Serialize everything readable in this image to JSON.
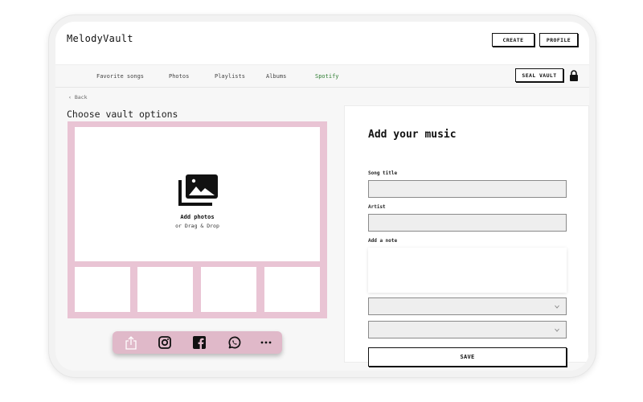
{
  "app": {
    "name": "MelodyVault"
  },
  "header": {
    "create_label": "CREATE",
    "profile_label": "PROFILE"
  },
  "nav": {
    "items": [
      {
        "label": "Favorite songs",
        "active": false
      },
      {
        "label": "Photos",
        "active": false
      },
      {
        "label": "Playlists",
        "active": false
      },
      {
        "label": "Albums",
        "active": false
      },
      {
        "label": "Spotify",
        "active": true
      }
    ],
    "seal_label": "SEAL VAULT",
    "lock_icon": "lock-icon"
  },
  "left": {
    "back_label": "Back",
    "title": "Choose vault options",
    "upload": {
      "title": "Add photos",
      "subtitle": "or Drag & Drop",
      "icon": "photo-library-icon"
    },
    "share_icons": [
      "share-icon",
      "instagram-icon",
      "facebook-icon",
      "whatsapp-icon",
      "more-icon"
    ]
  },
  "form": {
    "title": "Add your music",
    "song_title_label": "Song title",
    "artist_label": "Artist",
    "note_label": "Add a note",
    "song_title_value": "",
    "artist_value": "",
    "note_value": "",
    "select1_value": "",
    "select2_value": "",
    "save_label": "SAVE"
  },
  "colors": {
    "accent_pink": "#e9c4d4",
    "share_bar": "#e0b9c9",
    "active_nav": "#2e7d32",
    "text": "#111111"
  }
}
